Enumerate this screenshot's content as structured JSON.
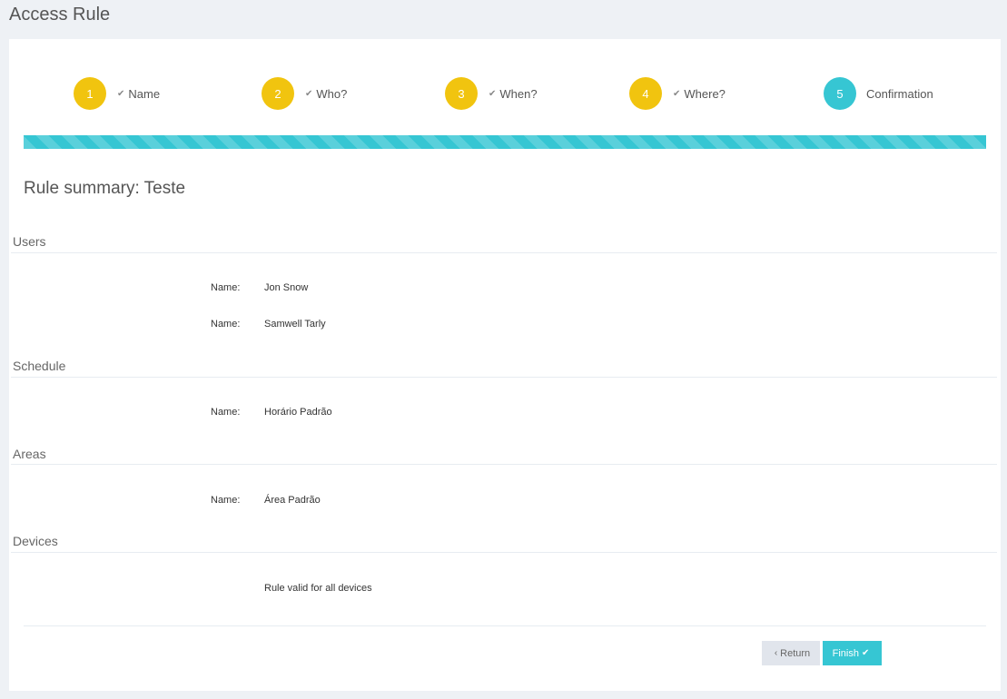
{
  "page": {
    "title": "Access Rule"
  },
  "wizard": {
    "steps": [
      {
        "number": "1",
        "label": "Name",
        "check": "✔"
      },
      {
        "number": "2",
        "label": "Who?",
        "check": "✔"
      },
      {
        "number": "3",
        "label": "When?",
        "check": "✔"
      },
      {
        "number": "4",
        "label": "Where?",
        "check": "✔"
      },
      {
        "number": "5",
        "label": "Confirmation"
      }
    ],
    "progress_percent": 100,
    "colors": {
      "done": "#f1c40f",
      "active": "#36c6d3"
    }
  },
  "summary": {
    "title": "Rule summary: Teste",
    "sections": {
      "users": {
        "title": "Users",
        "rows": [
          {
            "label": "Name:",
            "value": "Jon Snow"
          },
          {
            "label": "Name:",
            "value": "Samwell Tarly"
          }
        ]
      },
      "schedule": {
        "title": "Schedule",
        "rows": [
          {
            "label": "Name:",
            "value": "Horário Padrão"
          }
        ]
      },
      "areas": {
        "title": "Areas",
        "rows": [
          {
            "label": "Name:",
            "value": "Área Padrão"
          }
        ]
      },
      "devices": {
        "title": "Devices",
        "note": "Rule valid for all devices"
      }
    }
  },
  "actions": {
    "return_label": "Return",
    "return_icon": "‹",
    "finish_label": "Finish",
    "finish_icon": "✔"
  }
}
